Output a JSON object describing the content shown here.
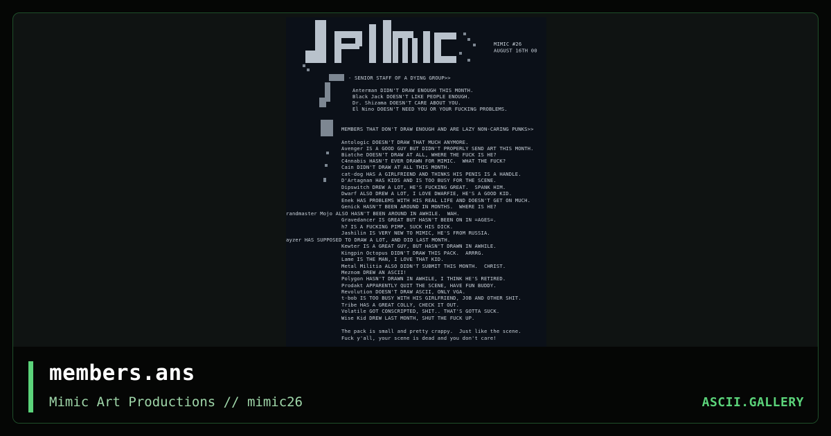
{
  "colors": {
    "accent": "#5bd37a",
    "border": "#1f4f2a",
    "card_bg": "#0f1312",
    "footer_bg": "#050605",
    "preview_bg": "#0b1018"
  },
  "artwork": {
    "header_lines": [
      "MIMIC #26",
      "AUGUST 16TH 00"
    ],
    "lines": [
      "- SENIOR STAFF OF A DYING GROUP>>",
      "Anterman DIDN'T DRAW ENOUGH THIS MONTH.",
      "Black Jack DOESN'T LIKE PEOPLE ENOUGH.",
      "Dr. Shizama DOESN'T CARE ABOUT YOU.",
      "El Nino DOESN'T NEED YOU OR YOUR FUCKING PROBLEMS.",
      "MEMBERS THAT DON'T DRAW ENOUGH AND ARE LAZY NON-CARING PUNKS>>",
      "Antologic DOESN'T DRAW THAT MUCH ANYMORE.",
      "Avenger IS A GOOD GUY BUT DIDN'T PROPERLY SEND ART THIS MONTH.",
      "Biatche DOESN'T DRAW AT ALL, WHERE THE FUCK IS HE?",
      "C4nnabis HASN'T EVER DRAWN FOR MIMIC.  WHAT THE FUCK?",
      "Cain DIDN'T DRAW AT ALL THIS MONTH.",
      "cat-dog HAS A GIRLFRIEND AND THINKS HIS PENIS IS A HANDLE.",
      "D'Artagnan HAS KIDS AND IS TOO BUSY FOR THE SCENE.",
      "Dipswitch DREW A LOT, HE'S FUCKING GREAT.  SPANK HIM.",
      "Dwarf ALSO DREW A LOT, I LOVE DWARFIE, HE'S A GOOD KID.",
      "Enek HAS PROBLEMS WITH HIS REAL LIFE AND DOESN'T GET ON MUCH.",
      "Genick HASN'T BEEN AROUND IN MONTHS.  WHERE IS HE?",
      "randmaster Mojo ALSO HASN'T BEEN AROUND IN AWHILE.  WAH.",
      "Gravedancer IS GREAT BUT HASN'T BEEN ON IN =AGES=.",
      "h7 IS A FUCKING PIMP, SUCK HIS DICK.",
      "Jashilin IS VERY NEW TO MIMIC, HE'S FROM RUSSIA.",
      "ayzer HAS SUPPOSED TO DRAW A LOT, AND DID LAST MONTH.",
      "Kewter IS A GREAT GUY, BUT HASN'T DRAWN IN AWHILE.",
      "Kingpin Octopus DIDN'T DRAW THIS PACK.  ARRRG.",
      "Lame IS THE MAN, I LOVE THAT KID.",
      "Metal Militia ALSO DIDN'T SUBMIT THIS MONTH.  CHRIST.",
      "Meznom DREW AN ASCII!",
      "Polygon HASN'T DRAWN IN AWHILE, I THINK HE'S RETIRED.",
      "Prodakt APPARENTLY QUIT THE SCENE, HAVE FUN BUDDY.",
      "Revolution DOESN'T DRAW ASCII, ONLY VGA.",
      "t-bob IS TOO BUSY WITH HIS GIRLFRIEND, JOB AND OTHER SHIT.",
      "Tribe HAS A GREAT COLLY, CHECK IT OUT.",
      "Volatile GOT CONSCRIPTED, SHIT.. THAT'S GOTTA SUCK.",
      "Wise Kid DREW LAST MONTH, SHUT THE FUCK UP.",
      "The pack is small and pretty crappy.  Just like the scene.",
      "Fuck y'all, your scene is dead and you don't care!"
    ]
  },
  "footer": {
    "title": "members.ans",
    "subtitle": "Mimic Art Productions // mimic26",
    "brand": "ASCII.GALLERY"
  }
}
